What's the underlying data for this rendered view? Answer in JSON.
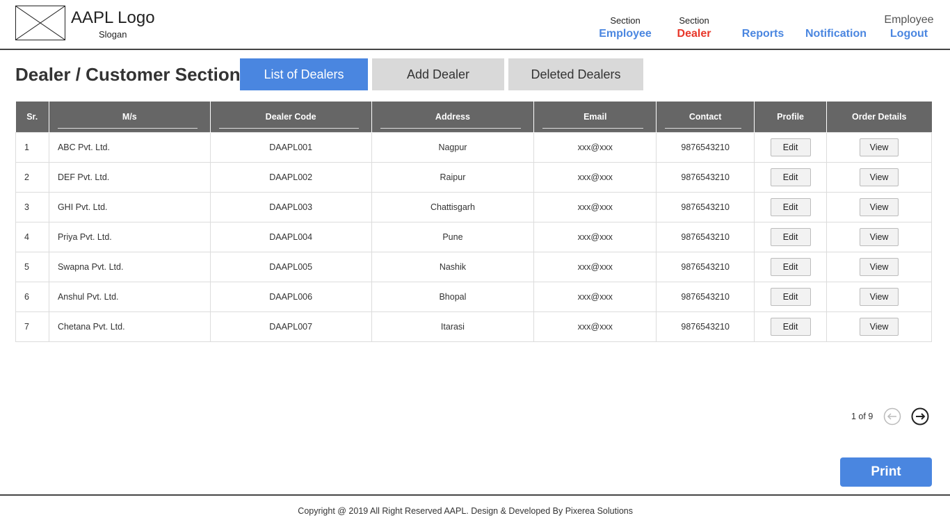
{
  "header": {
    "logo_text": "AAPL Logo",
    "slogan": "Slogan",
    "nav": [
      {
        "small": "Section",
        "label": "Employee",
        "active": false
      },
      {
        "small": "Section",
        "label": "Dealer",
        "active": true
      },
      {
        "small": "",
        "label": "Reports",
        "active": false
      },
      {
        "small": "",
        "label": "Notification",
        "active": false
      }
    ],
    "user": {
      "label": "Employee",
      "logout": "Logout"
    }
  },
  "page": {
    "title": "Dealer / Customer Section",
    "tabs": [
      "List of Dealers",
      "Add Dealer",
      "Deleted Dealers"
    ]
  },
  "table": {
    "headers": [
      "Sr.",
      "M/s",
      "Dealer Code",
      "Address",
      "Email",
      "Contact",
      "Profile",
      "Order Details"
    ],
    "edit_label": "Edit",
    "view_label": "View",
    "rows": [
      {
        "sr": "1",
        "ms": "ABC Pvt. Ltd.",
        "code": "DAAPL001",
        "address": "Nagpur",
        "email": "xxx@xxx",
        "contact": "9876543210"
      },
      {
        "sr": "2",
        "ms": "DEF Pvt. Ltd.",
        "code": "DAAPL002",
        "address": "Raipur",
        "email": "xxx@xxx",
        "contact": "9876543210"
      },
      {
        "sr": "3",
        "ms": "GHI Pvt. Ltd.",
        "code": "DAAPL003",
        "address": "Chattisgarh",
        "email": "xxx@xxx",
        "contact": "9876543210"
      },
      {
        "sr": "4",
        "ms": "Priya Pvt. Ltd.",
        "code": "DAAPL004",
        "address": "Pune",
        "email": "xxx@xxx",
        "contact": "9876543210"
      },
      {
        "sr": "5",
        "ms": "Swapna Pvt. Ltd.",
        "code": "DAAPL005",
        "address": "Nashik",
        "email": "xxx@xxx",
        "contact": "9876543210"
      },
      {
        "sr": "6",
        "ms": "Anshul Pvt. Ltd.",
        "code": "DAAPL006",
        "address": "Bhopal",
        "email": "xxx@xxx",
        "contact": "9876543210"
      },
      {
        "sr": "7",
        "ms": "Chetana Pvt. Ltd.",
        "code": "DAAPL007",
        "address": "Itarasi",
        "email": "xxx@xxx",
        "contact": "9876543210"
      }
    ]
  },
  "pagination": {
    "text": "1 of 9",
    "prev_icon": "arrow-left-circle",
    "next_icon": "arrow-right-circle"
  },
  "actions": {
    "print": "Print"
  },
  "footer": {
    "copyright": "Copyright @ 2019 All Right Reserved AAPL. Design & Developed By Pixerea Solutions"
  },
  "colors": {
    "accent": "#4a86e0",
    "active_nav": "#e8372a",
    "table_header": "#666666",
    "tab_inactive": "#d9d9d9"
  }
}
